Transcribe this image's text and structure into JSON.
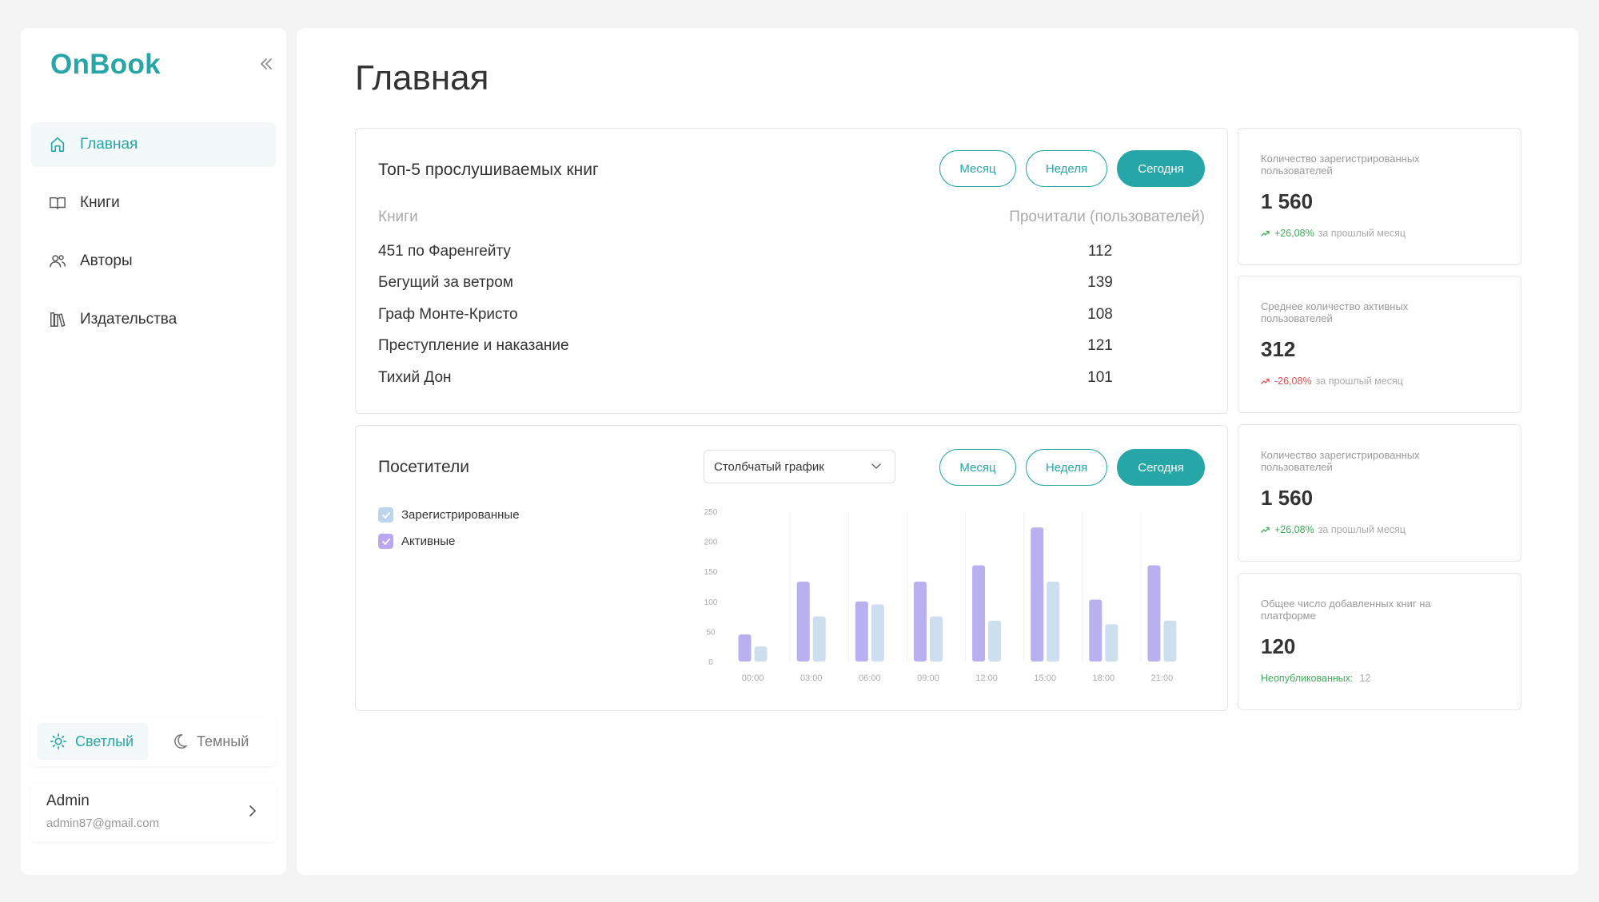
{
  "brand": {
    "logo": "OnBook"
  },
  "sidebar": {
    "items": [
      {
        "label": "Главная"
      },
      {
        "label": "Книги"
      },
      {
        "label": "Авторы"
      },
      {
        "label": "Издательства"
      }
    ],
    "theme": {
      "light": "Светлый",
      "dark": "Темный"
    },
    "user": {
      "name": "Admin",
      "email": "admin87@gmail.com"
    }
  },
  "main": {
    "title": "Главная"
  },
  "filters": {
    "month": "Месяц",
    "week": "Неделя",
    "today": "Сегодня"
  },
  "top_books": {
    "title": "Топ-5 прослушиваемых книг",
    "col_book": "Книги",
    "col_read": "Прочитали (пользователей)",
    "rows": [
      {
        "title": "451 по Фаренгейту",
        "value": "112"
      },
      {
        "title": "Бегущий за ветром",
        "value": "139"
      },
      {
        "title": "Граф Монте-Кристо",
        "value": "108"
      },
      {
        "title": "Преступление и наказание",
        "value": "121"
      },
      {
        "title": "Тихий Дон",
        "value": "101"
      }
    ]
  },
  "visitors": {
    "title": "Посетители",
    "chart_type_select": "Столбчатый график",
    "legend": {
      "registered": "Зарегистрированные",
      "active": "Активные"
    }
  },
  "stats": [
    {
      "title": "Количество зарегистрированных пользователей",
      "value": "1 560",
      "change": "+26,08%",
      "suffix": "за прошлый месяц",
      "trend": "up"
    },
    {
      "title": "Среднее количество активных пользователей",
      "value": "312",
      "change": "-26,08%",
      "suffix": "за прошлый месяц",
      "trend": "down"
    },
    {
      "title": "Количество зарегистрированных пользователей",
      "value": "1 560",
      "change": "+26,08%",
      "suffix": "за прошлый месяц",
      "trend": "up"
    },
    {
      "title": "Общее число добавленных книг на платформе",
      "value": "120",
      "change": "Неопубликованных:",
      "suffix": "12",
      "trend": "none"
    }
  ],
  "colors": {
    "accent": "#27a6a8",
    "active_series": "#b9b0f0",
    "registered_series": "#cddeee",
    "up": "#3fae5a",
    "down": "#e05050"
  },
  "chart_data": {
    "type": "bar",
    "categories": [
      "00:00",
      "03:00",
      "06:00",
      "09:00",
      "12:00",
      "15:00",
      "18:00",
      "21:00"
    ],
    "series": [
      {
        "name": "Активные",
        "values": [
          45,
          133,
          100,
          133,
          160,
          223,
          103,
          160
        ]
      },
      {
        "name": "Зарегистрированные",
        "values": [
          25,
          75,
          95,
          75,
          68,
          133,
          62,
          68
        ]
      }
    ],
    "yticks": [
      0,
      50,
      100,
      150,
      200,
      250
    ],
    "ylim": [
      0,
      250
    ],
    "grid": true
  }
}
